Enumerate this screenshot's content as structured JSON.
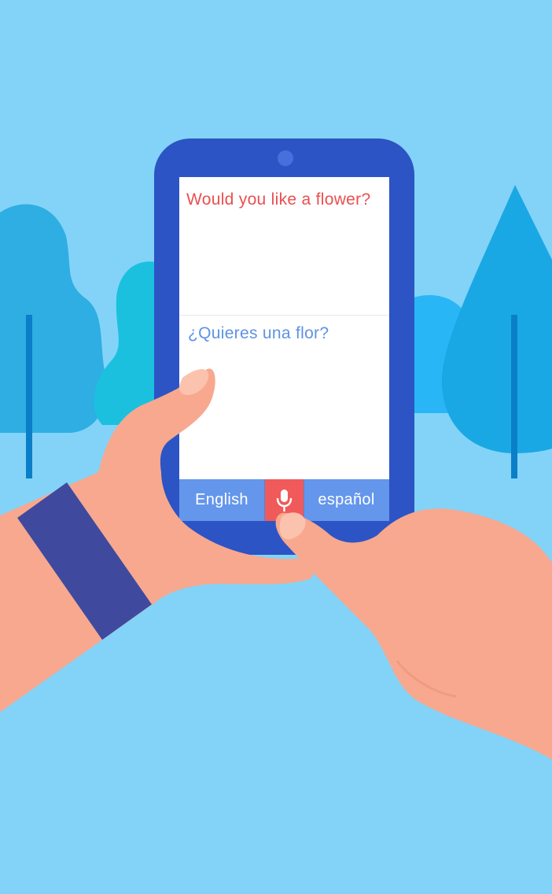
{
  "translator": {
    "source_text": "Would you like a flower?",
    "target_text": "¿Quieres una flor?",
    "source_language": "English",
    "target_language": "español",
    "mic_icon": "microphone-icon"
  },
  "colors": {
    "background": "#83d3f8",
    "phone_body": "#2c54c4",
    "source_text": "#ea4f4f",
    "target_text": "#5d93e3",
    "language_bar": "#6496ec",
    "mic_button": "#f05a5a",
    "skin": "#f7a88e",
    "wristband": "#3f4a9e"
  }
}
